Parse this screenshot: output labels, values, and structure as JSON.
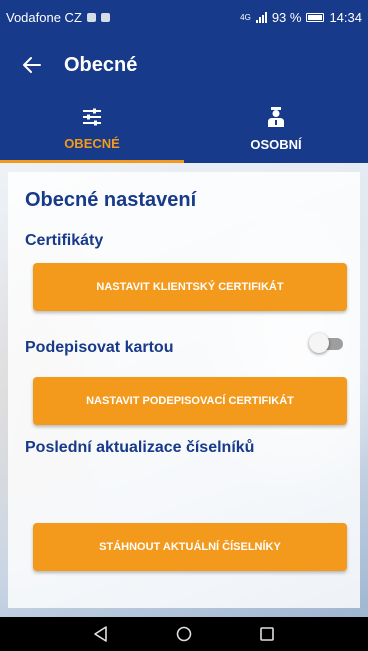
{
  "status_bar": {
    "carrier": "Vodafone CZ",
    "network_type": "4G",
    "battery": "93 %",
    "time": "14:34"
  },
  "app_bar": {
    "title": "Obecné",
    "back_icon": "arrow-left-icon"
  },
  "tabs": [
    {
      "label": "OBECNÉ",
      "icon": "sliders-icon",
      "active": true
    },
    {
      "label": "OSOBNÍ",
      "icon": "person-icon",
      "active": false
    }
  ],
  "settings": {
    "heading": "Obecné nastavení",
    "certificates_label": "Certifikáty",
    "client_cert_button": "NASTAVIT KLIENTSKÝ CERTIFIKÁT",
    "sign_with_card_label": "Podepisovat kartou",
    "sign_with_card_enabled": false,
    "signing_cert_button": "NASTAVIT PODEPISOVACÍ CERTIFIKÁT",
    "last_update_label": "Poslední aktualizace číselníků",
    "download_button": "STÁHNOUT AKTUÁLNÍ ČÍSELNÍKY"
  },
  "nav_bar": {
    "back": "nav-back-icon",
    "home": "nav-home-icon",
    "recents": "nav-recents-icon"
  },
  "colors": {
    "primary": "#173a8a",
    "accent": "#f39a1c"
  }
}
